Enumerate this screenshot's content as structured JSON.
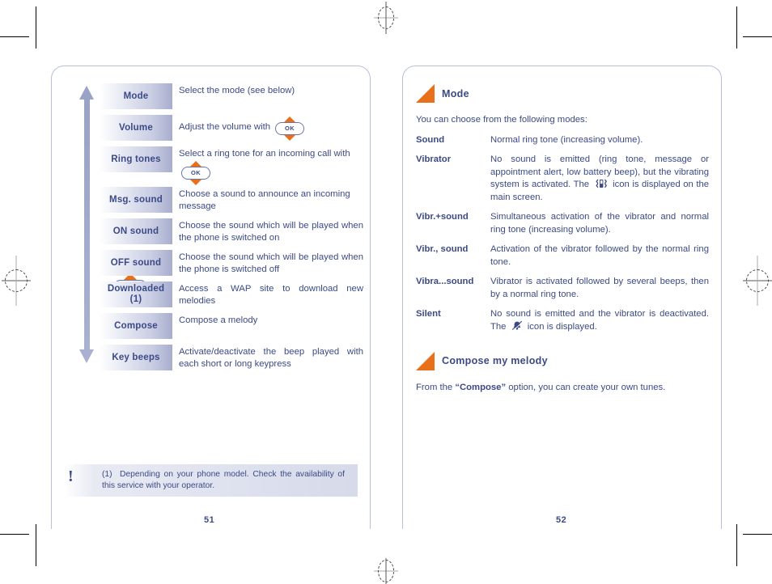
{
  "document": {
    "left_page": {
      "page_number": "51",
      "menu_rows": [
        {
          "label": "Mode",
          "description": "Select the mode (see below)",
          "icon_after": null
        },
        {
          "label": "Volume",
          "description": "Adjust the volume with",
          "icon_after": "ok-nav-key-icon"
        },
        {
          "label": "Ring tones",
          "description": "Select a ring tone for an incoming call with",
          "icon_after": "ok-nav-key-icon"
        },
        {
          "label": "Msg. sound",
          "description": "Choose a sound to announce an incoming message",
          "icon_after": null
        },
        {
          "label": "ON sound",
          "description": "Choose the sound which will be played when the phone is switched on",
          "icon_after": null
        },
        {
          "label": "OFF sound",
          "description": "Choose the sound which will be played when the phone is switched off",
          "icon_after": null
        },
        {
          "label": "Downloaded (1)",
          "description": "Access a WAP site to download new melodies",
          "icon_after": null
        },
        {
          "label": "Compose",
          "description": "Compose a melody",
          "icon_after": null
        },
        {
          "label": "Key beeps",
          "description": "Activate/deactivate the beep played with each short or long keypress",
          "icon_after": null
        }
      ],
      "ok_key_label": "OK",
      "footnote": {
        "marker": "!",
        "number": "(1)",
        "text": "Depending on your phone model. Check the availability of this service with your operator."
      }
    },
    "right_page": {
      "page_number": "52",
      "sections": [
        {
          "heading": "Mode",
          "intro": "You can choose from the following modes:",
          "items": [
            {
              "term": "Sound",
              "def_before": "Normal ring tone (increasing volume).",
              "icon": null,
              "def_after": ""
            },
            {
              "term": "Vibrator",
              "def_before": "No sound is emitted (ring tone, message or appointment alert, low battery beep), but the vibrating system is activated. The",
              "icon": "vibrate-icon",
              "def_after": "icon is displayed on the main screen."
            },
            {
              "term": "Vibr.+sound",
              "def_before": "Simultaneous activation of the vibrator and normal ring tone (increasing volume).",
              "icon": null,
              "def_after": ""
            },
            {
              "term": "Vibr., sound",
              "def_before": "Activation of the vibrator followed by the normal ring tone.",
              "icon": null,
              "def_after": ""
            },
            {
              "term": "Vibra...sound",
              "def_before": "Vibrator is activated followed by several beeps, then by a normal ring tone.",
              "icon": null,
              "def_after": ""
            },
            {
              "term": "Silent",
              "def_before": "No sound is emitted and the vibrator is deactivated. The",
              "icon": "silent-icon",
              "def_after": "icon is displayed."
            }
          ]
        },
        {
          "heading": "Compose my melody",
          "tail_before": "From the ",
          "tail_bold": "“Compose”",
          "tail_after": " option, you can create your own tunes."
        }
      ]
    },
    "colors": {
      "text_blue": "#3b4a86",
      "accent_orange": "#e8701a",
      "chip_gradient_end": "#a7adcd",
      "page_border": "#b9bedb"
    }
  }
}
